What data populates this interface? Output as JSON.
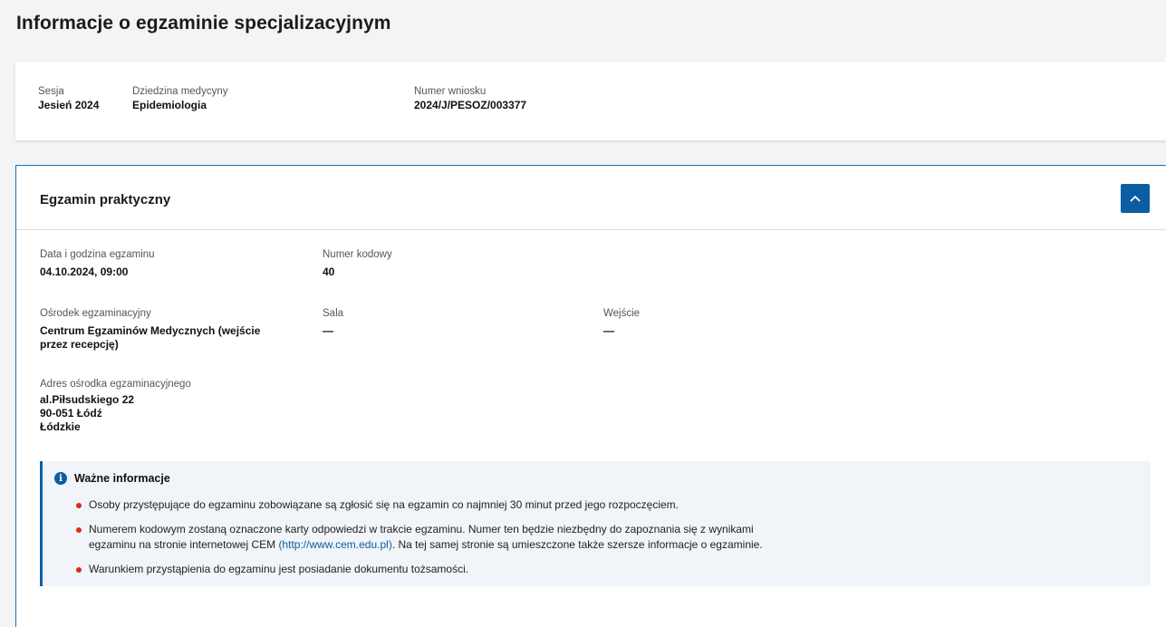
{
  "page": {
    "title": "Informacje o egzaminie specjalizacyjnym"
  },
  "summary": {
    "session_label": "Sesja",
    "session_value": "Jesień 2024",
    "field_label": "Dziedzina medycyny",
    "field_value": "Epidemiologia",
    "application_label": "Numer wniosku",
    "application_value": "2024/J/PESOZ/003377"
  },
  "exam": {
    "title": "Egzamin praktyczny",
    "collapse_icon": "chevron-up-icon",
    "datetime_label": "Data i godzina egzaminu",
    "datetime_value": "04.10.2024, 09:00",
    "code_label": "Numer kodowy",
    "code_value": "40",
    "center_label": "Ośrodek egzaminacyjny",
    "center_value": "Centrum Egzaminów Medycznych (wejście przez recepcję)",
    "room_label": "Sala",
    "room_value": "—",
    "entrance_label": "Wejście",
    "entrance_value": "—",
    "address_label": "Adres ośrodka egzaminacyjnego",
    "address_line1": "al.Piłsudskiego 22",
    "address_line2": "90-051 Łódź",
    "address_line3": "Łódzkie"
  },
  "info": {
    "title": "Ważne informacje",
    "icon": "info-icon",
    "item1": "Osoby przystępujące do egzaminu zobowiązane są zgłosić się na egzamin co najmniej 30 minut przed jego rozpoczęciem.",
    "item2_part1": "Numerem kodowym zostaną oznaczone karty odpowiedzi w trakcie egzaminu. Numer ten będzie niezbędny do zapoznania się z wynikami",
    "item2_part2": "egzaminu na stronie internetowej CEM ",
    "item2_link": "(http://www.cem.edu.pl)",
    "item2_part3": ". Na tej samej stronie są umieszczone także szersze informacje o egzaminie.",
    "item3": "Warunkiem przystąpienia do egzaminu jest posiadanie dokumentu tożsamości."
  },
  "colors": {
    "accent": "#0b5ea3",
    "bullet": "#d32f14",
    "info_bg": "#f1f4f8"
  }
}
